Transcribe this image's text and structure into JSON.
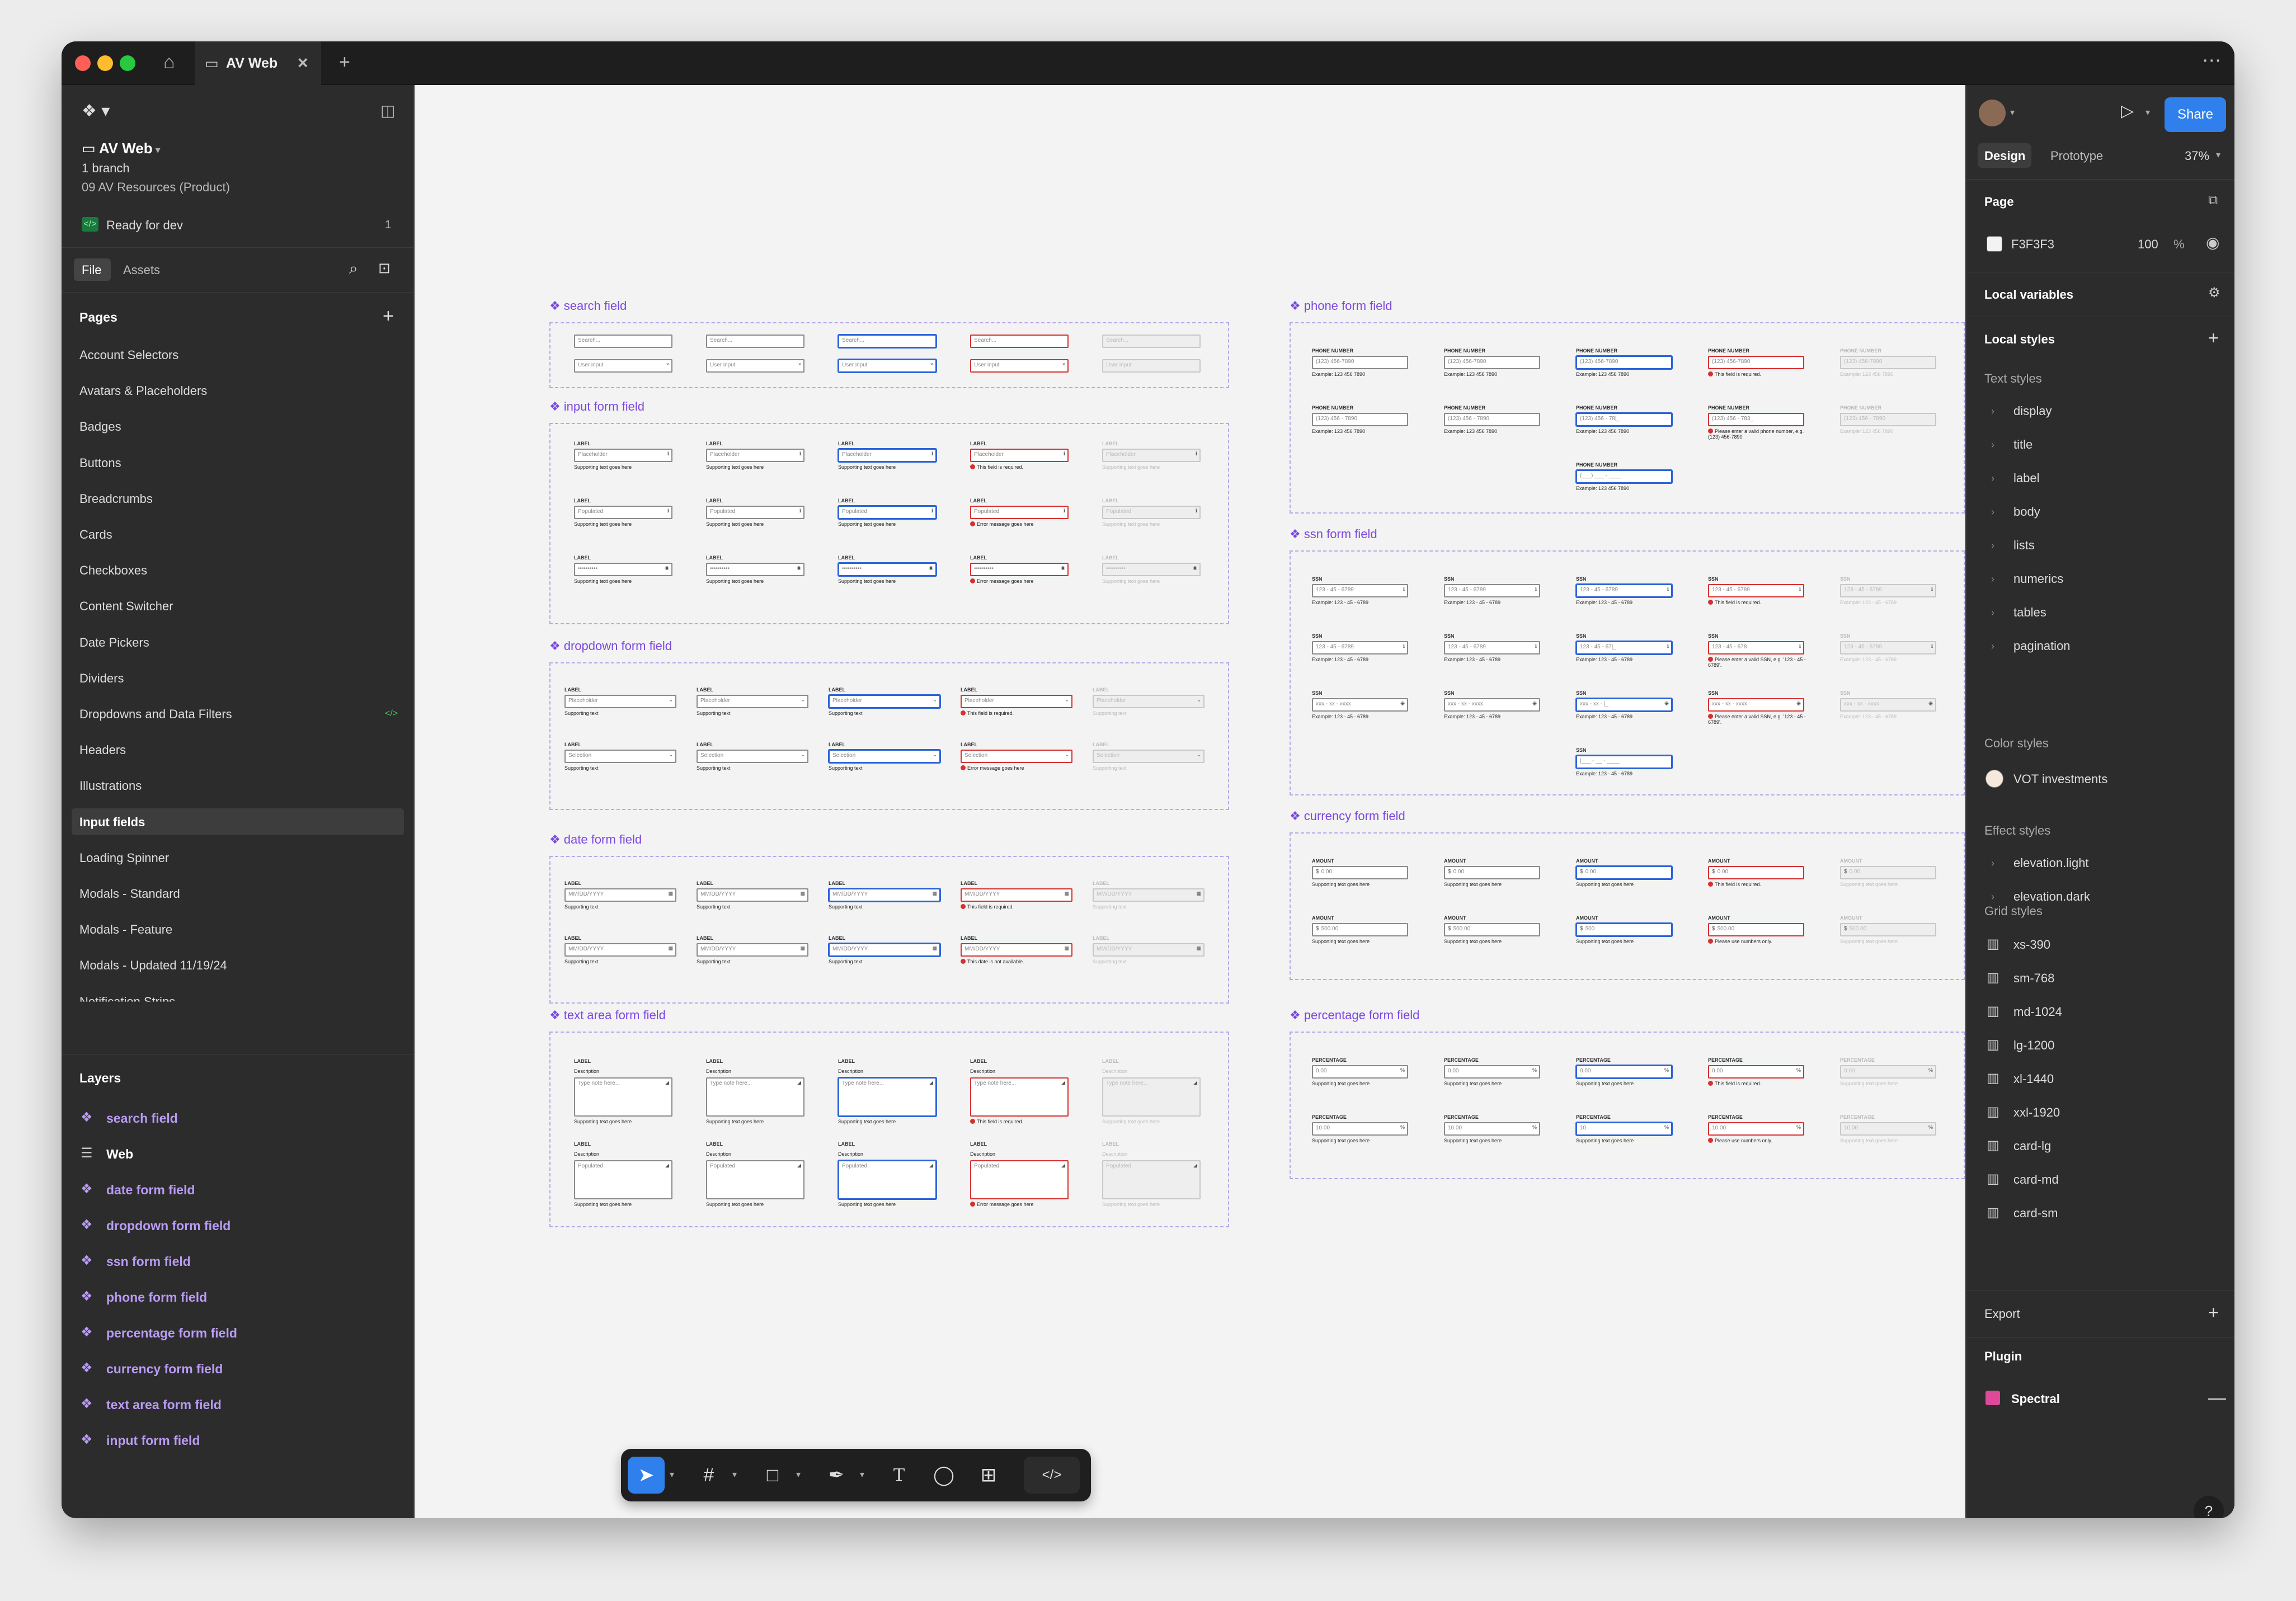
{
  "window": {
    "tab_title": "AV Web"
  },
  "left_panel": {
    "file_name": "AV Web",
    "branch": "1 branch",
    "project": "09 AV Resources (Product)",
    "dev_status": "Ready for dev",
    "dev_count": "1",
    "tabs": [
      "File",
      "Assets"
    ],
    "pages_header": "Pages",
    "pages": [
      "Account Selectors",
      "Avatars & Placeholders",
      "Badges",
      "Buttons",
      "Breadcrumbs",
      "Cards",
      "Checkboxes",
      "Content Switcher",
      "Date Pickers",
      "Dividers",
      "Dropdowns and Data Filters",
      "Headers",
      "Illustrations",
      "Input fields",
      "Loading Spinner",
      "Modals - Standard",
      "Modals - Feature",
      "Modals - Updated 11/19/24",
      "Notification Strips"
    ],
    "selected_page": "Input fields",
    "layers_header": "Layers",
    "layers": [
      "search field",
      "Web",
      "date form field",
      "dropdown form field",
      "ssn form field",
      "phone form field",
      "percentage form field",
      "currency form field",
      "text area form field",
      "input form field"
    ]
  },
  "right_panel": {
    "share_label": "Share",
    "tabs": [
      "Design",
      "Prototype"
    ],
    "zoom": "37%",
    "page_header": "Page",
    "page_color": "F3F3F3",
    "page_opacity": "100",
    "percent_sign": "%",
    "local_variables": "Local variables",
    "local_styles": "Local styles",
    "text_styles_header": "Text styles",
    "text_styles": [
      "display",
      "title",
      "label",
      "body",
      "lists",
      "numerics",
      "tables",
      "pagination"
    ],
    "color_styles_header": "Color styles",
    "color_styles": [
      "VOT investments"
    ],
    "effect_styles_header": "Effect styles",
    "effect_styles": [
      "elevation.light",
      "elevation.dark"
    ],
    "grid_styles_header": "Grid styles",
    "grid_styles": [
      "xs-390",
      "sm-768",
      "md-1024",
      "lg-1200",
      "xl-1440",
      "xxl-1920",
      "card-lg",
      "card-md",
      "card-sm"
    ],
    "export_header": "Export",
    "plugin_header": "Plugin",
    "plugin_name": "Spectral",
    "help_label": "?"
  },
  "canvas": {
    "frames": {
      "search": "search field",
      "input": "input form field",
      "dropdown": "dropdown form field",
      "date": "date form field",
      "textarea": "text area form field",
      "phone": "phone form field",
      "ssn": "ssn form field",
      "currency": "currency form field",
      "percentage": "percentage form field"
    },
    "strings": {
      "label": "LABEL",
      "phone_label": "PHONE NUMBER",
      "ssn_label": "SSN",
      "amount_label": "AMOUNT",
      "percentage_label": "PERCENTAGE",
      "description": "Description",
      "search_ph": "Search...",
      "user_input": "User input",
      "placeholder": "Placeholder",
      "populated": "Populated",
      "masked": "••••••••••",
      "supporting": "Supporting text goes here",
      "supporting_short": "Supporting text",
      "required": "This field is required.",
      "error_msg": "Error message goes here",
      "selection": "Selection",
      "date_ph": "MM/DD/YYYY",
      "date_err": "This date is not available.",
      "textarea_ph": "Type note here...",
      "phone_ph": "(123) 456-7890",
      "phone_typed": "(123) 456 - 7890",
      "phone_partial": "(123) 456 - 78|_",
      "phone_partial_err": "(123) 456 - 783_",
      "phone_empty": "(___) ___ - ____",
      "phone_example": "Example: 123 456 7890",
      "phone_err": "Please enter a valid phone number, e.g. (123) 456-7890",
      "ssn_ph": "123 - 45 - 6789",
      "ssn_partial": "123 - 45 - 67|_",
      "ssn_partial_err": "123 - 45 - 678",
      "ssn_masked": "xxx - xx - xxxx",
      "ssn_masked_partial": "xxx - xx - |_",
      "ssn_empty": "|___ - __ - ____",
      "ssn_example": "Example: 123 - 45 - 6789",
      "ssn_err": "Please enter a valid SSN, e.g. '123 - 45 - 6789'.",
      "amount_zero": "0.00",
      "amount_val": "500.00",
      "amount_typed": "500",
      "numbers_only": "Please use numbers only.",
      "pct_zero": "0.00",
      "pct_val": "10.00",
      "pct_typed": "10",
      "dollar": "$",
      "pct": "%"
    }
  }
}
